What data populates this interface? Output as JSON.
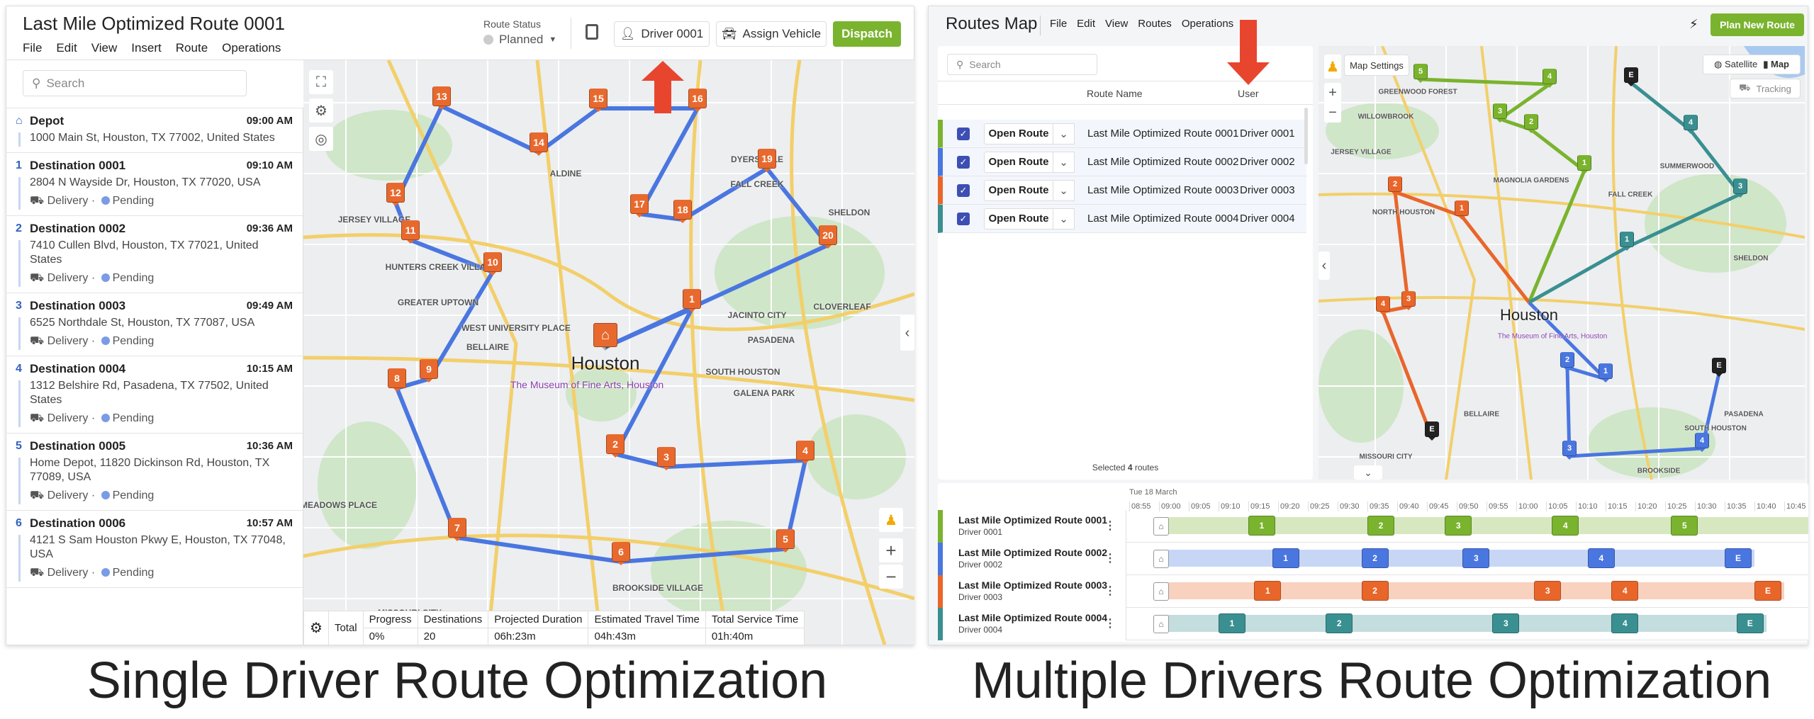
{
  "captions": {
    "left": "Single Driver Route Optimization",
    "right": "Multiple Drivers Route Optimization"
  },
  "colors": {
    "accent_green": "#7ab32e",
    "route_blue": "#4a76e0",
    "marker_orange": "#e8692e",
    "arrow_red": "#e8452f",
    "route1": "#7ab32e",
    "route2": "#4a76e0",
    "route3": "#e8662a",
    "route4": "#3a8f91"
  },
  "single": {
    "title": "Last Mile Optimized Route 0001",
    "menu": [
      "File",
      "Edit",
      "View",
      "Insert",
      "Route",
      "Operations"
    ],
    "route_status_label": "Route Status",
    "route_status": "Planned",
    "driver_button": "Driver 0001",
    "assign_vehicle_button": "Assign Vehicle",
    "dispatch_button": "Dispatch",
    "search_placeholder": "Search",
    "stops": [
      {
        "number": "",
        "name": "Depot",
        "time": "09:00 AM",
        "address": "1000 Main St, Houston, TX 77002, United States",
        "type": "",
        "status": ""
      },
      {
        "number": "1",
        "name": "Destination 0001",
        "time": "09:10 AM",
        "address": "2804 N Wayside Dr, Houston, TX 77020, USA",
        "type": "Delivery",
        "status": "Pending"
      },
      {
        "number": "2",
        "name": "Destination 0002",
        "time": "09:36 AM",
        "address": "7410 Cullen Blvd, Houston, TX 77021, United States",
        "type": "Delivery",
        "status": "Pending"
      },
      {
        "number": "3",
        "name": "Destination 0003",
        "time": "09:49 AM",
        "address": "6525 Northdale St, Houston, TX 77087, USA",
        "type": "Delivery",
        "status": "Pending"
      },
      {
        "number": "4",
        "name": "Destination 0004",
        "time": "10:15 AM",
        "address": "1312 Belshire Rd, Pasadena, TX 77502, United States",
        "type": "Delivery",
        "status": "Pending"
      },
      {
        "number": "5",
        "name": "Destination 0005",
        "time": "10:36 AM",
        "address": "Home Depot, 11820 Dickinson Rd, Houston, TX 77089, USA",
        "type": "Delivery",
        "status": "Pending"
      },
      {
        "number": "6",
        "name": "Destination 0006",
        "time": "10:57 AM",
        "address": "4121 S Sam Houston Pkwy E, Houston, TX 77048, USA",
        "type": "Delivery",
        "status": "Pending"
      }
    ],
    "map": {
      "markers": [
        "1",
        "2",
        "3",
        "4",
        "5",
        "6",
        "7",
        "8",
        "9",
        "10",
        "11",
        "12",
        "13",
        "14",
        "15",
        "16",
        "17",
        "18",
        "19",
        "20"
      ],
      "labels": [
        "Houston",
        "The Museum of Fine Arts, Houston",
        "Jersey Village",
        "Aldine",
        "Hunters Creek Village",
        "West University Place",
        "Bellaire",
        "Pasadena",
        "South Houston",
        "Sheldon",
        "Cloverleaf",
        "Jacinto City",
        "Galena Park",
        "Missouri City",
        "Meadows Place",
        "Brookside Village",
        "Dyersdale",
        "Greater Uptown",
        "Fall Creek"
      ]
    },
    "summary": {
      "label": "Total",
      "columns": [
        {
          "header": "Progress",
          "value": "0%"
        },
        {
          "header": "Destinations",
          "value": "20"
        },
        {
          "header": "Projected Duration",
          "value": "06h:23m"
        },
        {
          "header": "Estimated Travel Time",
          "value": "04h:43m"
        },
        {
          "header": "Total Service Time",
          "value": "01h:40m"
        }
      ]
    }
  },
  "multi": {
    "title": "Routes Map",
    "menu": [
      "File",
      "Edit",
      "View",
      "Routes",
      "Operations"
    ],
    "plan_button": "Plan New Route",
    "search_placeholder": "Search",
    "columns": {
      "route_name": "Route Name",
      "user": "User"
    },
    "open_route_label": "Open Route",
    "selected_prefix": "Selected",
    "selected_count": "4",
    "selected_suffix": "routes",
    "map_settings": "Map Settings",
    "satellite": "Satellite",
    "map_toggle": "Map",
    "tracking": "Tracking",
    "map_labels": [
      "Houston",
      "The Museum of Fine Arts, Houston",
      "Jersey Village",
      "Willowbrook",
      "Greenwood Forest",
      "North Houston",
      "Magnolia Gardens",
      "Fall Creek",
      "Summerwood",
      "Sheldon",
      "Pasadena",
      "South Houston",
      "Missouri City",
      "Brookside",
      "Bellaire"
    ],
    "routes": [
      {
        "name": "Last Mile Optimized Route 0001",
        "user": "Driver 0001",
        "color": "#7ab32e",
        "stops": [
          {
            "label": "1",
            "start": "09:15"
          },
          {
            "label": "2",
            "start": "09:35"
          },
          {
            "label": "3",
            "start": "09:48"
          },
          {
            "label": "4",
            "start": "10:06"
          },
          {
            "label": "5",
            "start": "10:26"
          }
        ],
        "end": "10:55"
      },
      {
        "name": "Last Mile Optimized Route 0002",
        "user": "Driver 0002",
        "color": "#4a76e0",
        "stops": [
          {
            "label": "1",
            "start": "09:19"
          },
          {
            "label": "2",
            "start": "09:34"
          },
          {
            "label": "3",
            "start": "09:51"
          },
          {
            "label": "4",
            "start": "10:12"
          },
          {
            "label": "E",
            "start": "10:35"
          }
        ],
        "end": "10:40"
      },
      {
        "name": "Last Mile Optimized Route 0003",
        "user": "Driver 0003",
        "color": "#e8662a",
        "stops": [
          {
            "label": "1",
            "start": "09:16"
          },
          {
            "label": "2",
            "start": "09:34"
          },
          {
            "label": "3",
            "start": "10:03"
          },
          {
            "label": "4",
            "start": "10:16"
          },
          {
            "label": "E",
            "start": "10:40"
          }
        ],
        "end": "10:45"
      },
      {
        "name": "Last Mile Optimized Route 0004",
        "user": "Driver 0004",
        "color": "#3a8f91",
        "stops": [
          {
            "label": "1",
            "start": "09:10"
          },
          {
            "label": "2",
            "start": "09:28"
          },
          {
            "label": "3",
            "start": "09:56"
          },
          {
            "label": "4",
            "start": "10:16"
          },
          {
            "label": "E",
            "start": "10:37"
          }
        ],
        "end": "10:42"
      }
    ],
    "map_markers": [
      [
        "1",
        "2",
        "3",
        "4",
        "5"
      ],
      [
        "1",
        "2",
        "3",
        "4",
        "E"
      ],
      [
        "1",
        "2",
        "3",
        "4",
        "E"
      ],
      [
        "1",
        "3",
        "4",
        "E"
      ]
    ],
    "timeline": {
      "date": "Tue 18 March",
      "ticks": [
        "08:55",
        "09:00",
        "09:05",
        "09:10",
        "09:15",
        "09:20",
        "09:25",
        "09:30",
        "09:35",
        "09:40",
        "09:45",
        "09:50",
        "09:55",
        "10:00",
        "10:05",
        "10:10",
        "10:15",
        "10:20",
        "10:25",
        "10:30",
        "10:35",
        "10:40",
        "10:45"
      ]
    }
  }
}
